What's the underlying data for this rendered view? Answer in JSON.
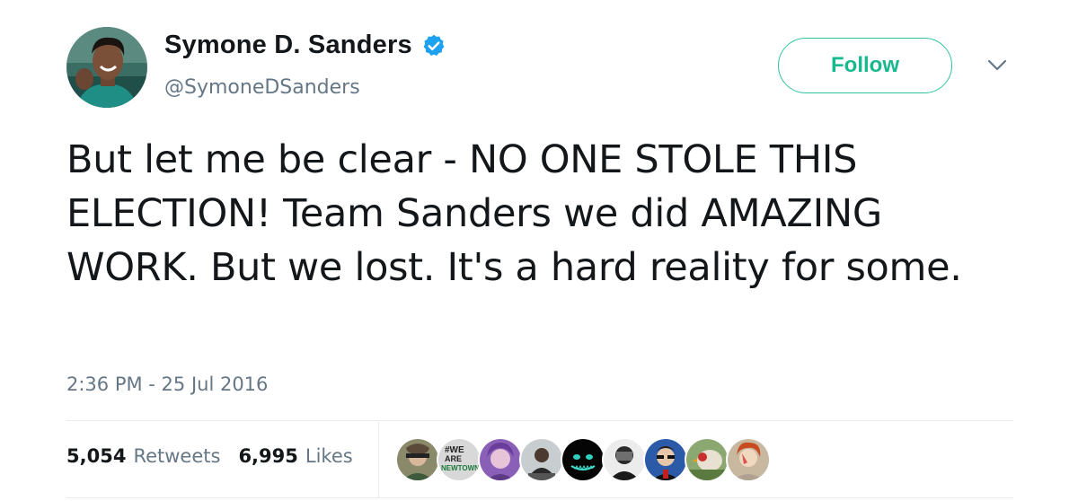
{
  "author": {
    "name": "Symone D. Sanders",
    "handle": "@SymoneDSanders",
    "verified": true,
    "verified_icon": "verified-badge-icon",
    "avatar_icon": "profile-avatar"
  },
  "actions": {
    "follow_label": "Follow",
    "more_icon": "chevron-down-icon"
  },
  "tweet": {
    "text": "But let me be clear - NO ONE STOLE THIS ELECTION! Team Sanders we did AMAZING WORK. But we lost. It's a hard reality for some.",
    "timestamp": "2:36 PM - 25 Jul 2016"
  },
  "stats": {
    "retweets_count": "5,054",
    "retweets_label": "Retweets",
    "likes_count": "6,995",
    "likes_label": "Likes"
  },
  "likers": {
    "badge_text": [
      "#WE",
      "ARE",
      "NEWTOWN"
    ]
  },
  "colors": {
    "accent_follow": "#18b88f",
    "verified_blue": "#1da1f2",
    "secondary_text": "#657786",
    "divider": "#e6ecf0"
  }
}
